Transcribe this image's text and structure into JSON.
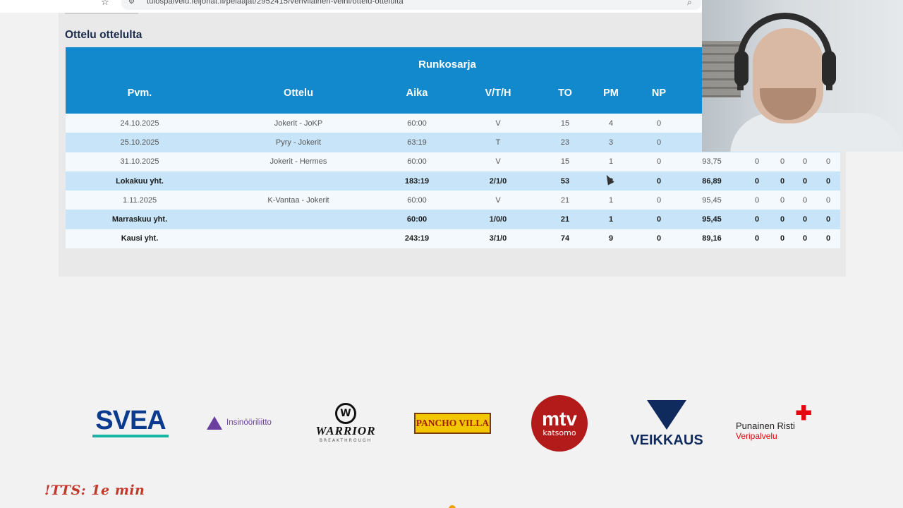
{
  "browser": {
    "url": "tulospalvelu.leijonat.fi/pelaajat/2952415/vehvilainen-veini/ottelu-ottelulta",
    "icons": [
      "bookmark-icon",
      "site-settings-icon",
      "zoom-icon"
    ]
  },
  "section": {
    "title": "Ottelu ottelulta"
  },
  "table": {
    "group_title": "Runkosarja",
    "headers": [
      "Pvm.",
      "Ottelu",
      "Aika",
      "V/T/H",
      "TO",
      "PM",
      "NP"
    ],
    "rows": [
      {
        "type": "game",
        "pvm": "24.10.2025",
        "ottelu": "Jokerit - JoKP",
        "aika": "60:00",
        "vth": "V",
        "to": "15",
        "pm": "4",
        "np": "0",
        "pct": "",
        "c1": "",
        "c2": "",
        "c3": "",
        "c4": ""
      },
      {
        "type": "game",
        "pvm": "25.10.2025",
        "ottelu": "Pyry - Jokerit",
        "aika": "63:19",
        "vth": "T",
        "to": "23",
        "pm": "3",
        "np": "0",
        "pct": "",
        "c1": "",
        "c2": "",
        "c3": "",
        "c4": ""
      },
      {
        "type": "game",
        "pvm": "31.10.2025",
        "ottelu": "Jokerit - Hermes",
        "aika": "60:00",
        "vth": "V",
        "to": "15",
        "pm": "1",
        "np": "0",
        "pct": "93,75",
        "c1": "0",
        "c2": "0",
        "c3": "0",
        "c4": "0"
      },
      {
        "type": "total",
        "pvm": "Lokakuu yht.",
        "ottelu": "",
        "aika": "183:19",
        "vth": "2/1/0",
        "to": "53",
        "pm": "8",
        "np": "0",
        "pct": "86,89",
        "c1": "0",
        "c2": "0",
        "c3": "0",
        "c4": "0"
      },
      {
        "type": "game",
        "pvm": "1.11.2025",
        "ottelu": "K-Vantaa - Jokerit",
        "aika": "60:00",
        "vth": "V",
        "to": "21",
        "pm": "1",
        "np": "0",
        "pct": "95,45",
        "c1": "0",
        "c2": "0",
        "c3": "0",
        "c4": "0"
      },
      {
        "type": "total",
        "pvm": "Marraskuu yht.",
        "ottelu": "",
        "aika": "60:00",
        "vth": "1/0/0",
        "to": "21",
        "pm": "1",
        "np": "0",
        "pct": "95,45",
        "c1": "0",
        "c2": "0",
        "c3": "0",
        "c4": "0"
      },
      {
        "type": "total",
        "pvm": "Kausi yht.",
        "ottelu": "",
        "aika": "243:19",
        "vth": "3/1/0",
        "to": "74",
        "pm": "9",
        "np": "0",
        "pct": "89,16",
        "c1": "0",
        "c2": "0",
        "c3": "0",
        "c4": "0"
      }
    ]
  },
  "sponsors": {
    "svea": "SVEA",
    "insinoori": "Insinööriliitto",
    "warrior": "WARRIOR",
    "warrior_sub": "BREAKTHROUGH",
    "pancho": "PANCHO VILLA",
    "mtv": "mtv",
    "mtv_sub": "katsomo",
    "veikkaus": "VEIKKAUS",
    "punainen_1": "Punainen Risti",
    "punainen_2": "Veripalvelu"
  },
  "overlay": {
    "tts": "!TTS: 1e min"
  },
  "colors": {
    "header_blue": "#1189cc",
    "row_blue": "#c8e4f8",
    "row_light": "#f4f9fd"
  }
}
